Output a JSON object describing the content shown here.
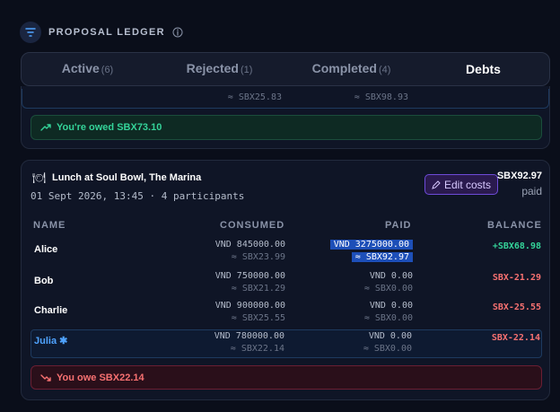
{
  "header": {
    "title": "PROPOSAL LEDGER"
  },
  "tabs": [
    {
      "label": "Active",
      "count": "(6)"
    },
    {
      "label": "Rejected",
      "count": "(1)"
    },
    {
      "label": "Completed",
      "count": "(4)"
    },
    {
      "label": "Debts",
      "count": ""
    }
  ],
  "active_tab": "Debts",
  "previous_card": {
    "consumed_fx": "≈ SBX25.83",
    "paid_fx": "≈ SBX98.93",
    "banner": "You're owed SBX73.10"
  },
  "card": {
    "icon": "🍽",
    "title": "Lunch at Soul Bowl, The Marina",
    "subtitle": "01 Sept 2026, 13:45 · 4 participants",
    "edit_label": "Edit costs",
    "total": "SBX92.97",
    "status": "paid",
    "columns": {
      "name": "NAME",
      "consumed": "CONSUMED",
      "paid": "PAID",
      "balance": "BALANCE"
    },
    "rows": [
      {
        "name": "Alice",
        "consumed": "VND 845000.00",
        "consumed_fx": "≈ SBX23.99",
        "paid": "VND 3275000.00",
        "paid_fx": "≈ SBX92.97",
        "balance": "+SBX68.98"
      },
      {
        "name": "Bob",
        "consumed": "VND 750000.00",
        "consumed_fx": "≈ SBX21.29",
        "paid": "VND 0.00",
        "paid_fx": "≈ SBX0.00",
        "balance": "SBX-21.29"
      },
      {
        "name": "Charlie",
        "consumed": "VND 900000.00",
        "consumed_fx": "≈ SBX25.55",
        "paid": "VND 0.00",
        "paid_fx": "≈ SBX0.00",
        "balance": "SBX-25.55"
      },
      {
        "name": "Julia ✱",
        "consumed": "VND 780000.00",
        "consumed_fx": "≈ SBX22.14",
        "paid": "VND 0.00",
        "paid_fx": "≈ SBX0.00",
        "balance": "SBX-22.14"
      }
    ],
    "banner": "You owe SBX22.14"
  },
  "colors": {
    "positive": "#34d399",
    "negative": "#f87171",
    "accent": "#6d4bd8",
    "link": "#4fa3ff"
  }
}
